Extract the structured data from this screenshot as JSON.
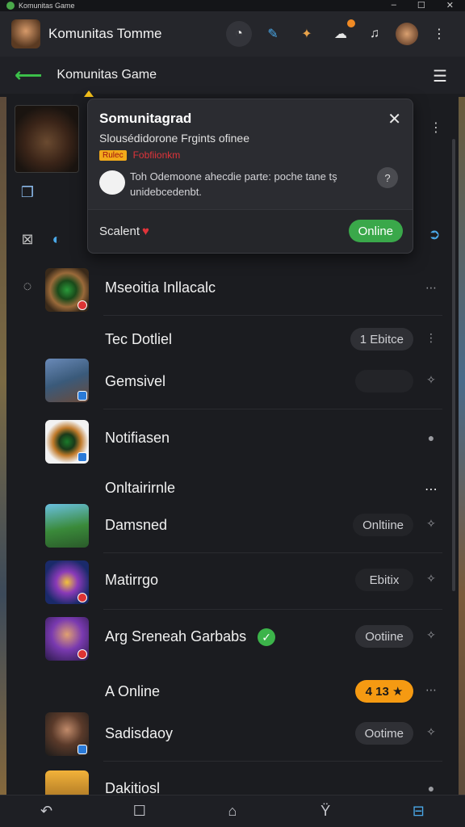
{
  "os": {
    "title": "Komunitas Game",
    "minimize": "–",
    "maximize": "☐",
    "close": "✕"
  },
  "header": {
    "title": "Komunitas Tomme",
    "icons": [
      "activity-icon",
      "chat-icon",
      "controller-icon",
      "message-icon",
      "bell-icon",
      "profile-avatar"
    ]
  },
  "nav": {
    "back": "⟵",
    "title": "Komunitas Game",
    "menu": "☰"
  },
  "popup": {
    "title": "Somunitagrad",
    "subtitle": "Slousédidorone Frgints ofinee",
    "tag": "Rulec",
    "tag_text": "Fobfiionkm",
    "body": "Toh Odemoone ahecdie parte: poche tane tş unidebcedenbt.",
    "pin": "?",
    "footer_label": "Scalent",
    "heart": "♥",
    "status": "Online",
    "close": "✕"
  },
  "rail": {
    "icons": [
      "cards-icon",
      "grid-icon",
      "refresh-icon"
    ]
  },
  "list": {
    "rows": [
      {
        "name": "Mseoitia Inllacalc",
        "action": "⋯"
      },
      {
        "label": "Tec Dotliel",
        "pill": "1 Ebitce",
        "action": "⋮"
      },
      {
        "name": "Gemsivel",
        "pill": "",
        "action": "✧"
      },
      {
        "name": "Notifiasen",
        "action": "●"
      },
      {
        "label": "Onltairirnle",
        "action": "⋯"
      },
      {
        "name": "Damsned",
        "pill": "Onltiine",
        "action": "✧"
      },
      {
        "name": "Matirrgo",
        "pill": "Ebitix",
        "action": "✧"
      },
      {
        "name": "Arg Sreneah Garbabs",
        "pill": "Ootiine",
        "action": "✧"
      },
      {
        "label": "A Online",
        "pill": "4 13 ★",
        "action": "⋯"
      },
      {
        "name": "Sadisdaoy",
        "pill": "Ootime",
        "action": "✧"
      },
      {
        "name": "Dakitiosl",
        "action": "●"
      }
    ]
  },
  "bottom_nav": {
    "items": [
      "↶",
      "☐",
      "⌂",
      "Ϋ",
      "⊟"
    ]
  },
  "colors": {
    "accent_green": "#3aa84a",
    "accent_orange": "#f59a12",
    "accent_blue": "#4aa8e8"
  }
}
